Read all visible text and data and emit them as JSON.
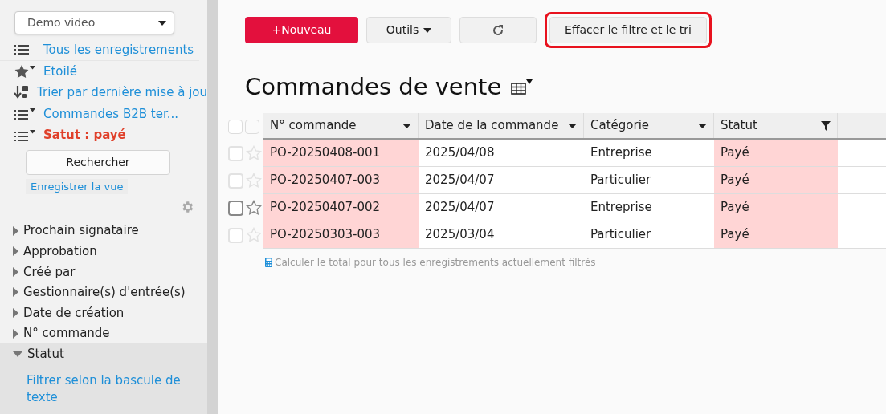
{
  "sidebar": {
    "app_select": {
      "value": "Demo video"
    },
    "views": [
      {
        "kind": "list",
        "label": "Tous les enregistrements",
        "selected": false
      },
      {
        "kind": "star-filter",
        "label": "Etoilé",
        "selected": false
      },
      {
        "kind": "sort",
        "label": "Trier par dernière mise à jou",
        "selected": false
      },
      {
        "kind": "list-filter",
        "label": "Commandes B2B ter...",
        "selected": false
      },
      {
        "kind": "list-filter",
        "label": "Satut : payé",
        "selected": true
      }
    ],
    "search_button": "Rechercher",
    "save_view_link": "Enregistrer la vue",
    "filters": [
      {
        "label": "Prochain signataire",
        "expanded": false
      },
      {
        "label": "Approbation",
        "expanded": false
      },
      {
        "label": "Créé par",
        "expanded": false
      },
      {
        "label": "Gestionnaire(s) d'entrée(s)",
        "expanded": false
      },
      {
        "label": "Date de création",
        "expanded": false
      },
      {
        "label": "N° commande",
        "expanded": false
      },
      {
        "label": "Statut",
        "expanded": true,
        "link": "Filtrer selon la bascule de texte"
      }
    ]
  },
  "toolbar": [
    {
      "kind": "primary",
      "label": "+Nouveau",
      "highlighted": false
    },
    {
      "kind": "menu",
      "label": "Outils",
      "highlighted": false
    },
    {
      "kind": "refresh",
      "highlighted": false
    },
    {
      "kind": "plain",
      "label": "Effacer le filtre et le tri",
      "highlighted": true
    }
  ],
  "title": "Commandes de vente",
  "table": {
    "columns": [
      {
        "label": "N° commande",
        "filtered": false,
        "highlighted": true
      },
      {
        "label": "Date de la commande",
        "filtered": false,
        "highlighted": false
      },
      {
        "label": "Catégorie",
        "filtered": false,
        "highlighted": false
      },
      {
        "label": "Statut",
        "filtered": true,
        "highlighted": true
      }
    ],
    "all_checked": false,
    "rows": [
      {
        "hovered": false,
        "checked": false,
        "cells": [
          "PO-20250408-001",
          "2025/04/08",
          "Entreprise",
          "Payé"
        ]
      },
      {
        "hovered": false,
        "checked": false,
        "cells": [
          "PO-20250407-003",
          "2025/04/07",
          "Particulier",
          "Payé"
        ]
      },
      {
        "hovered": true,
        "checked": false,
        "cells": [
          "PO-20250407-002",
          "2025/04/07",
          "Entreprise",
          "Payé"
        ]
      },
      {
        "hovered": false,
        "checked": false,
        "cells": [
          "PO-20250303-003",
          "2025/03/04",
          "Particulier",
          "Payé"
        ]
      }
    ],
    "total_link": "Calculer le total pour tous les enregistrements actuellement filtrés"
  }
}
